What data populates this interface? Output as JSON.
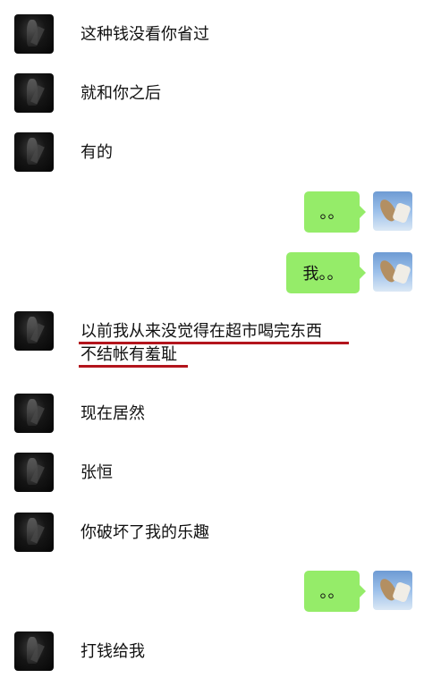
{
  "messages": [
    {
      "side": "left",
      "text": "这种钱没看你省过"
    },
    {
      "side": "left",
      "text": "就和你之后"
    },
    {
      "side": "left",
      "text": "有的"
    },
    {
      "side": "right",
      "text": "。。"
    },
    {
      "side": "right",
      "text": "我。。"
    },
    {
      "side": "left",
      "line1": "以前我从来没觉得在超市喝完东西",
      "line2": "不结帐有羞耻"
    },
    {
      "side": "left",
      "text": "现在居然"
    },
    {
      "side": "left",
      "text": "张恒"
    },
    {
      "side": "left",
      "text": "你破坏了我的乐趣"
    },
    {
      "side": "right",
      "text": "。。"
    },
    {
      "side": "left",
      "text": "打钱给我"
    }
  ],
  "colors": {
    "bubble_right": "#95ec69",
    "underline": "#b3141c"
  }
}
